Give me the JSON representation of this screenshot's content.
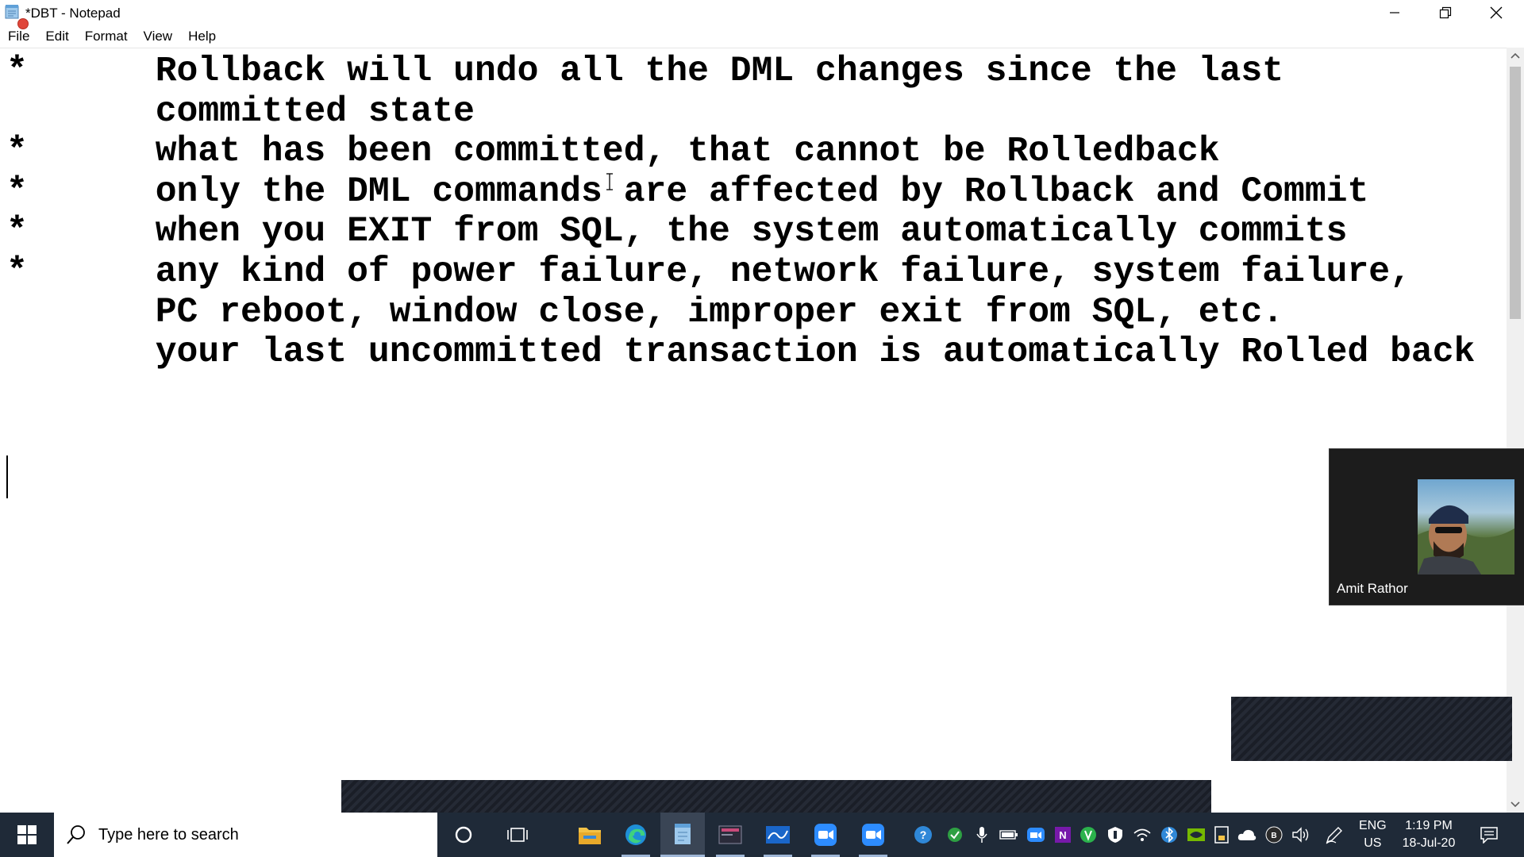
{
  "window": {
    "title": "*DBT - Notepad",
    "icons": {
      "app": "notepad-icon",
      "minimize": "minimize-icon",
      "restore": "restore-icon",
      "close": "close-icon"
    }
  },
  "menu": {
    "items": [
      "File",
      "Edit",
      "Format",
      "View",
      "Help"
    ]
  },
  "editor": {
    "lines": [
      "*      Rollback will undo all the DML changes since the last",
      "       committed state",
      "*      what has been committed, that cannot be Rolledback",
      "*      only the DML commands are affected by Rollback and Commit",
      "*      when you EXIT from SQL, the system automatically commits",
      "*      any kind of power failure, network failure, system failure,",
      "       PC reboot, window close, improper exit from SQL, etc.",
      "       your last uncommitted transaction is automatically Rolled back"
    ]
  },
  "video_tile": {
    "participant_name": "Amit Rathor"
  },
  "taskbar": {
    "search_placeholder": "Type here to search",
    "pinned": [
      "cortana-icon",
      "task-view-icon",
      "file-explorer-icon",
      "edge-icon",
      "notepad-icon",
      "app-icon",
      "whiteboard-icon",
      "zoom-icon",
      "zoom-meeting-icon"
    ],
    "tray": [
      "help-icon",
      "shield-check-icon",
      "microphone-icon",
      "battery-icon",
      "camera-icon",
      "onenote-icon",
      "green-app-icon",
      "security-icon",
      "wifi-icon",
      "bluetooth-icon",
      "nvidia-icon",
      "device-icon",
      "cloud-icon",
      "sync-icon",
      "volume-icon",
      "pen-icon"
    ],
    "language": {
      "line1": "ENG",
      "line2": "US"
    },
    "clock": {
      "time": "1:19 PM",
      "date": "18-Jul-20"
    },
    "notifications": "notification-icon"
  }
}
